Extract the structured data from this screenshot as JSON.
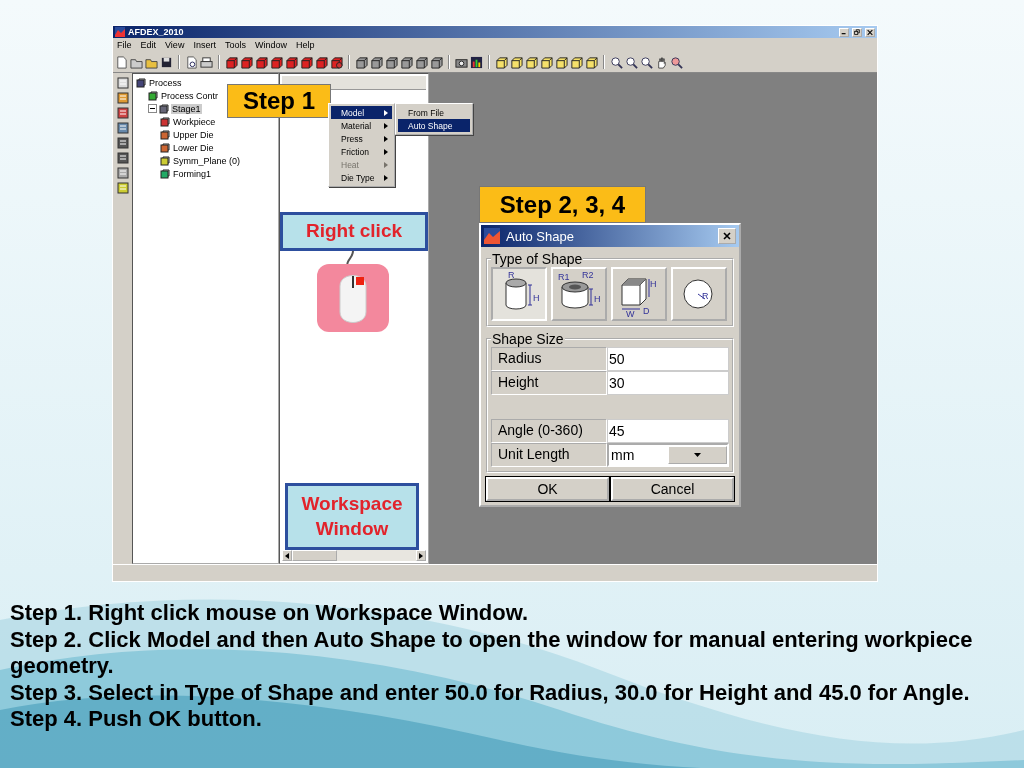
{
  "app_window": {
    "title": "AFDEX_2010",
    "menu": [
      "File",
      "Edit",
      "View",
      "Insert",
      "Tools",
      "Window",
      "Help"
    ]
  },
  "tree": [
    {
      "label": "Process",
      "selected": false,
      "children": [
        {
          "label": "Process Contr",
          "selected": false,
          "kind": "control"
        },
        {
          "label": "Stage1",
          "selected": true,
          "expanded": true,
          "kind": "stage",
          "children": [
            {
              "label": "Workpiece",
              "selected": false,
              "kind": "workpiece"
            },
            {
              "label": "Upper Die",
              "selected": false,
              "kind": "die"
            },
            {
              "label": "Lower Die",
              "selected": false,
              "kind": "die"
            },
            {
              "label": "Symm_Plane (0)",
              "selected": false,
              "kind": "plane"
            },
            {
              "label": "Forming1",
              "selected": false,
              "kind": "forming"
            }
          ]
        }
      ]
    }
  ],
  "context_menu": [
    {
      "label": "Model",
      "selected": true,
      "disabled": false
    },
    {
      "label": "Material",
      "selected": false,
      "disabled": false
    },
    {
      "label": "Press",
      "selected": false,
      "disabled": false
    },
    {
      "label": "Friction",
      "selected": false,
      "disabled": false
    },
    {
      "label": "Heat",
      "selected": false,
      "disabled": true
    },
    {
      "label": "Die Type",
      "selected": false,
      "disabled": false
    }
  ],
  "submenu": [
    {
      "label": "From File",
      "selected": false
    },
    {
      "label": "Auto Shape",
      "selected": true
    }
  ],
  "step1_callout": "Step 1",
  "right_click_callout": "Right click",
  "workspace_callout": "Workspace Window",
  "step234_callout": "Step 2, 3, 4",
  "dialog": {
    "title": "Auto Shape",
    "type_group": "Type of Shape",
    "shapes": [
      {
        "kind": "cylinder",
        "labels": [
          "R",
          "H"
        ],
        "selected": true
      },
      {
        "kind": "ring",
        "labels": [
          "R1",
          "R2",
          "H"
        ],
        "selected": false
      },
      {
        "kind": "box",
        "labels": [
          "H",
          "W",
          "D"
        ],
        "selected": false
      },
      {
        "kind": "sphere",
        "labels": [
          "R"
        ],
        "selected": false
      }
    ],
    "size_group": "Shape Size",
    "fields": [
      {
        "kind": "text",
        "label": "Radius",
        "value": "50"
      },
      {
        "kind": "text",
        "label": "Height",
        "value": "30"
      },
      {
        "kind": "gap"
      },
      {
        "kind": "text",
        "label": "Angle (0-360)",
        "value": "45"
      },
      {
        "kind": "select",
        "label": "Unit Length",
        "value": "mm"
      }
    ],
    "buttons": [
      "OK",
      "Cancel"
    ]
  },
  "instructions": [
    "Step 1. Right click mouse on Workspace Window.",
    "Step 2. Click Model and then Auto Shape to open the window for manual entering workpiece geometry.",
    "Step 3. Select in Type of Shape and enter 50.0 for Radius, 30.0 for Height and 45.0 for Angle.",
    "Step 4. Push OK button."
  ]
}
